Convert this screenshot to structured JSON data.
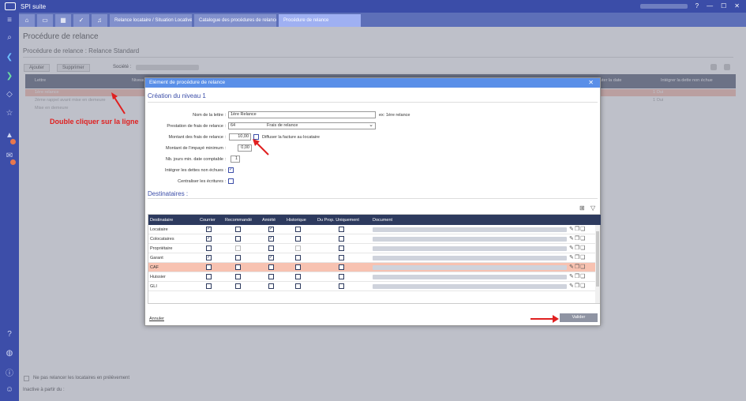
{
  "app": {
    "title": "SPI suite"
  },
  "tabs": [
    {
      "label": "Relance locataire / Situation Locative"
    },
    {
      "label": "Catalogue des procédures de relance"
    },
    {
      "label": "Procédure de relance"
    }
  ],
  "page": {
    "title": "Procédure de relance",
    "subtitle": "Procédure de relance : Relance Standard",
    "add_label": "Ajouter",
    "delete_label": "Supprimer",
    "societe_label": "Société :"
  },
  "bg_table": {
    "headers": [
      "Lettre",
      "Niveau",
      "Ajouter la date",
      "Intégrer la dette non échue"
    ],
    "rows": [
      {
        "label": "1ère relance",
        "val": "1  Oui"
      },
      {
        "label": "2ème rappel avant mise en demeure",
        "val": "1  Oui"
      },
      {
        "label": "Mise en demeure",
        "val": ""
      }
    ]
  },
  "bottom": {
    "no_relance_label": "Ne pas relancer les locataires en prélèvement",
    "inactive_label": "Inactive à partir du :"
  },
  "annotation": {
    "text": "Double cliquer sur la ligne"
  },
  "dialog": {
    "title": "Elément de procédure de relance",
    "subtitle": "Création du niveau 1",
    "fields": {
      "nom_label": "Nom de la lettre :",
      "nom_value": "1ère Relance",
      "nom_hint": "ex: 1ère relance",
      "prestation_label": "Prestation de frais de relance :",
      "prestation_code": "64",
      "prestation_value": "Frais de relance",
      "montant_frais_label": "Montant des frais de relance :",
      "montant_frais_value": "10,00",
      "diffuser_label": "Diffuser la facture au locataire",
      "montant_impaye_label": "Montant de l'impayé minimum :",
      "montant_impaye_value": "0,00",
      "nb_jours_label": "Nb. jours min. date comptable :",
      "nb_jours_value": "1",
      "integrer_label": "Intégrer les dettes non échues :",
      "centraliser_label": "Centraliser les écritures :"
    },
    "dest_title": "Destinataires :",
    "grid": {
      "headers": [
        "Destinataire",
        "Courrier",
        "Recommandé",
        "Amiété",
        "Historique",
        "Du Prop. Uniquement",
        "Document"
      ],
      "rows": [
        {
          "name": "Locataire",
          "checks": [
            true,
            false,
            true,
            false,
            false
          ]
        },
        {
          "name": "Colocataires",
          "checks": [
            true,
            false,
            true,
            false,
            false
          ]
        },
        {
          "name": "Propriétaire",
          "checks": [
            false,
            false,
            false,
            false,
            false
          ]
        },
        {
          "name": "Garant",
          "checks": [
            true,
            false,
            true,
            false,
            false
          ]
        },
        {
          "name": "CAF",
          "checks": [
            false,
            false,
            false,
            false,
            false
          ]
        },
        {
          "name": "Huissier",
          "checks": [
            false,
            false,
            false,
            false,
            false
          ]
        },
        {
          "name": "GLI",
          "checks": [
            false,
            false,
            false,
            false,
            false
          ]
        }
      ]
    },
    "annuler_label": "Annuler",
    "valider_label": "Valider"
  }
}
